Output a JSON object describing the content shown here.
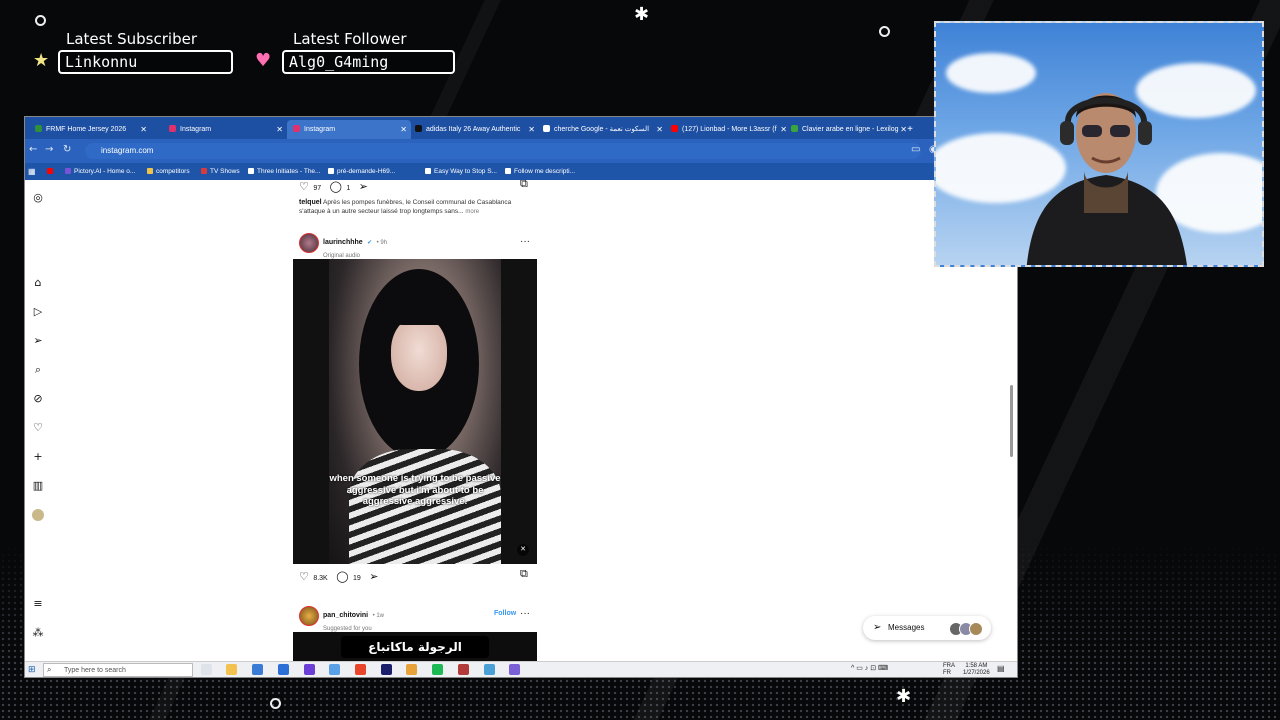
{
  "overlay": {
    "subscriber_label": "Latest Subscriber",
    "subscriber_name": "Linkonnu",
    "follower_label": "Latest Follower",
    "follower_name": "Alg0_G4ming",
    "star_icon": "star-icon",
    "heart_icon": "heart-icon",
    "accent_star": "#f1e486",
    "accent_heart": "#ff6fb2"
  },
  "browser": {
    "tabs": [
      {
        "label": "FRMF Home Jersey 2026",
        "active": false,
        "fav": "#2f8f3a"
      },
      {
        "label": "Instagram",
        "active": false,
        "fav": "#e1306c"
      },
      {
        "label": "Instagram",
        "active": true,
        "fav": "#e1306c"
      },
      {
        "label": "adidas Italy 26 Away Authentic",
        "active": false,
        "fav": "#111111"
      },
      {
        "label": "cherche Google - السكوت نعمة",
        "active": false,
        "fav": "#ffffff"
      },
      {
        "label": "(127) Lionbad - More L3assr (f",
        "active": false,
        "fav": "#ff0000"
      },
      {
        "label": "Clavier arabe en ligne - Lexilog",
        "active": false,
        "fav": "#3aa53a"
      }
    ],
    "new_tab": "+",
    "address": "instagram.com",
    "bookmarks": [
      {
        "label": "Pictory.AI - Home o...",
        "color": "#7a52d6"
      },
      {
        "label": "competitors",
        "color": "#f0c24a"
      },
      {
        "label": "TV Shows",
        "color": "#d83b3b"
      },
      {
        "label": "Three Initiates - The...",
        "color": "#ffffff"
      },
      {
        "label": "pré-demande-H69...",
        "color": "#ffffff"
      },
      {
        "label": "Easy Way to Stop S...",
        "color": "#ffffff"
      },
      {
        "label": "Follow me descripti...",
        "color": "#ffffff"
      }
    ]
  },
  "feed": {
    "prev_post": {
      "likes": "97",
      "comments": "1",
      "author": "telquel",
      "caption": "Après les pompes funèbres, le Conseil communal de Casablanca s'attaque à un autre secteur laissé trop longtemps sans...",
      "more": "more"
    },
    "post": {
      "author": "laurinchhhe",
      "verified": "✔",
      "time": "• 9h",
      "audio": "Original audio",
      "caption_overlay": "when someone is trying to be passive aggressive but i'm about to be aggressive aggressive.",
      "likes": "8.3K",
      "comments": "19"
    },
    "next_post": {
      "author": "pan_chitovini",
      "time": "• 1w",
      "subtitle": "Suggested for you",
      "follow": "Follow",
      "banner_text": "الرجولة ماكاتباع ماكاتشرا"
    },
    "messages_label": "Messages"
  },
  "taskbar": {
    "search_placeholder": "Type here to search",
    "lang": "FRA",
    "lang2": "FR",
    "time": "1:58 AM",
    "date": "1/27/2026"
  }
}
